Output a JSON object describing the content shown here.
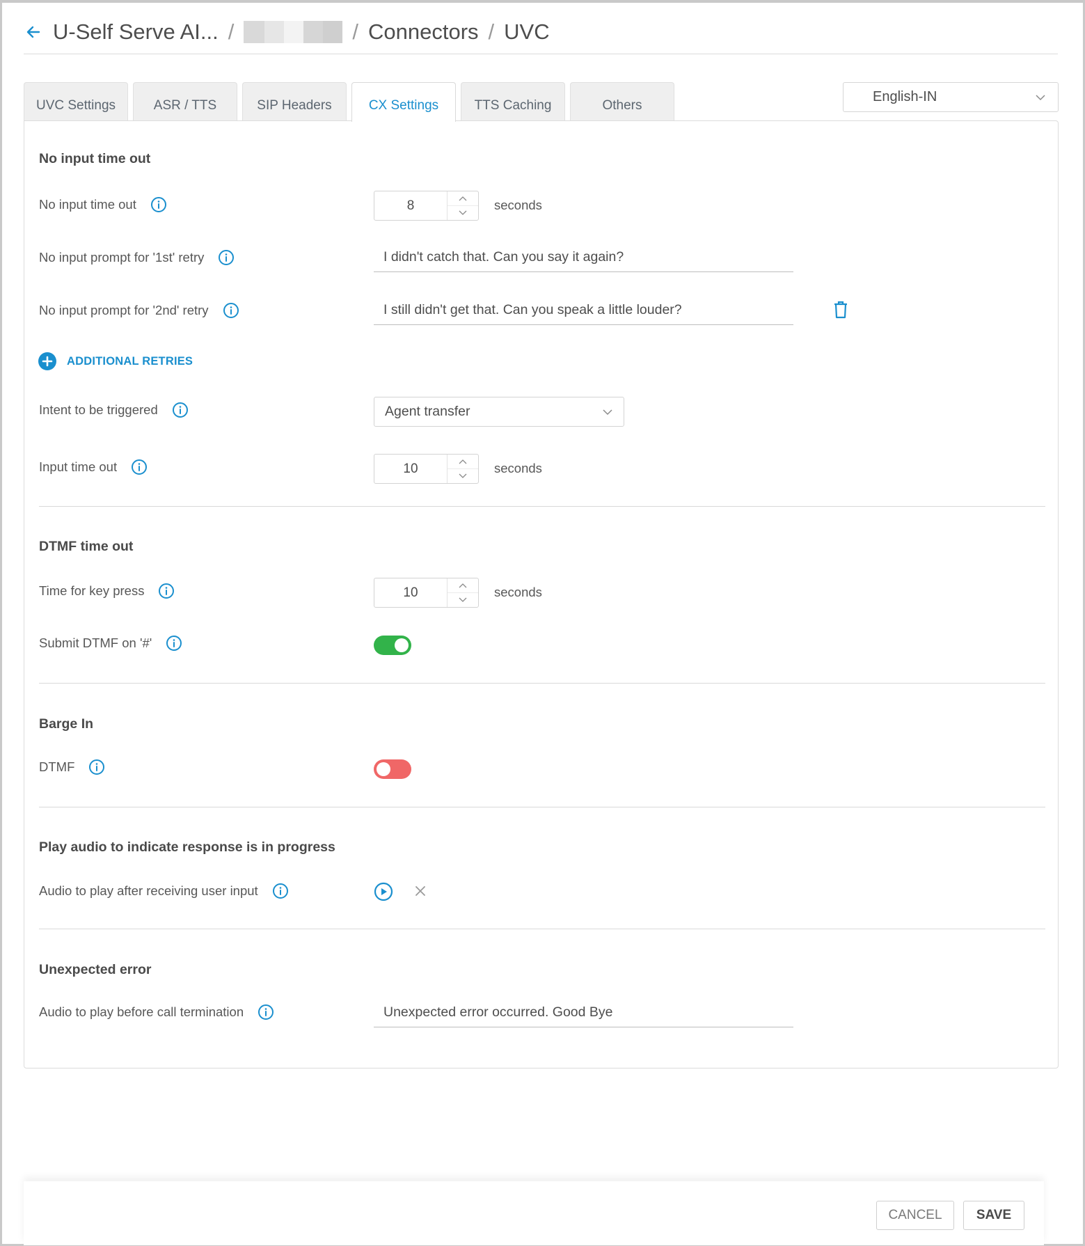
{
  "header": {
    "crumbs": [
      "U-Self Serve AI...",
      "Connectors",
      "UVC"
    ],
    "separator": "/"
  },
  "tabs": [
    {
      "label": "UVC Settings",
      "active": false
    },
    {
      "label": "ASR / TTS",
      "active": false
    },
    {
      "label": "SIP Headers",
      "active": false
    },
    {
      "label": "CX Settings",
      "active": true
    },
    {
      "label": "TTS Caching",
      "active": false
    },
    {
      "label": "Others",
      "active": false
    }
  ],
  "language": {
    "selected": "English-IN"
  },
  "no_input": {
    "title": "No input time out",
    "timeout_label": "No input time out",
    "timeout_value": "8",
    "unit": "seconds",
    "retry1_label": "No input prompt for '1st' retry",
    "retry1_value": "I didn't catch that. Can you say it again?",
    "retry2_label": "No input prompt for '2nd' retry",
    "retry2_value": "I still didn't get that. Can you speak a little louder?",
    "add_retries_label": "ADDITIONAL RETRIES",
    "intent_label": "Intent to be triggered",
    "intent_value": "Agent transfer",
    "input_timeout_label": "Input time out",
    "input_timeout_value": "10"
  },
  "dtmf_timeout": {
    "title": "DTMF time out",
    "keypress_label": "Time for key press",
    "keypress_value": "10",
    "unit": "seconds",
    "submit_label": "Submit DTMF on '#'",
    "submit_enabled": true
  },
  "barge_in": {
    "title": "Barge In",
    "dtmf_label": "DTMF",
    "dtmf_enabled": false
  },
  "play_audio": {
    "title": "Play audio to indicate response is in progress",
    "audio_label": "Audio to play after receiving user input"
  },
  "unexpected_error": {
    "title": "Unexpected error",
    "audio_label": "Audio to play before call termination",
    "audio_value": "Unexpected error occurred. Good Bye"
  },
  "footer": {
    "cancel_label": "CANCEL",
    "save_label": "SAVE"
  },
  "colors": {
    "accent": "#1a8fce",
    "toggle_on": "#32b34a",
    "toggle_off": "#f06767"
  },
  "icons": [
    "back-arrow-icon",
    "chevron-down-icon",
    "info-icon",
    "delete-icon",
    "add-circle-icon",
    "play-circle-icon",
    "close-icon",
    "chevron-up-icon"
  ]
}
